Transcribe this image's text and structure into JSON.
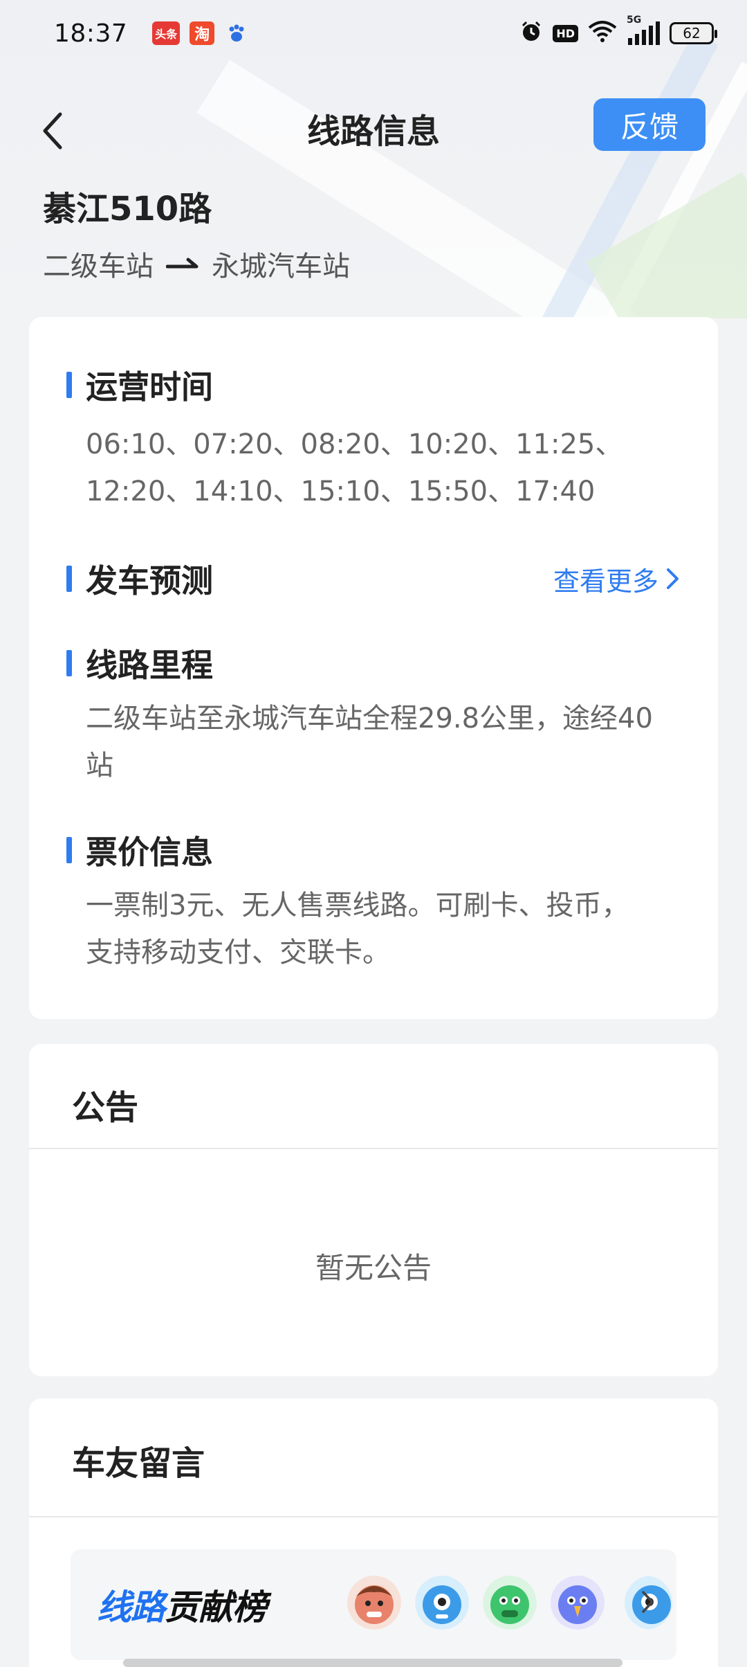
{
  "status_bar": {
    "time": "18:37",
    "apps": [
      "头条",
      "淘",
      "百度"
    ],
    "network": "5G",
    "battery": "62"
  },
  "header": {
    "title": "线路信息",
    "feedback_label": "反馈"
  },
  "route": {
    "name": "綦江510路",
    "from": "二级车站",
    "to": "永城汽车站"
  },
  "info": {
    "schedule": {
      "title": "运营时间",
      "line1": "06:10、07:20、08:20、10:20、11:25、",
      "line2": "12:20、14:10、15:10、15:50、17:40"
    },
    "forecast": {
      "title": "发车预测",
      "more_label": "查看更多"
    },
    "mileage": {
      "title": "线路里程",
      "line1": "二级车站至永城汽车站全程29.8公里，途经40",
      "line2": "站"
    },
    "fare": {
      "title": "票价信息",
      "line1": "一票制3元、无人售票线路。可刷卡、投币，",
      "line2": "支持移动支付、交联卡。"
    }
  },
  "notice": {
    "title": "公告",
    "empty_text": "暂无公告"
  },
  "messages": {
    "title": "车友留言",
    "rank_blue": "线路",
    "rank_black": "贡献榜"
  },
  "colors": {
    "accent": "#2f7cf0",
    "feedback_bg": "#3d8ff5"
  }
}
